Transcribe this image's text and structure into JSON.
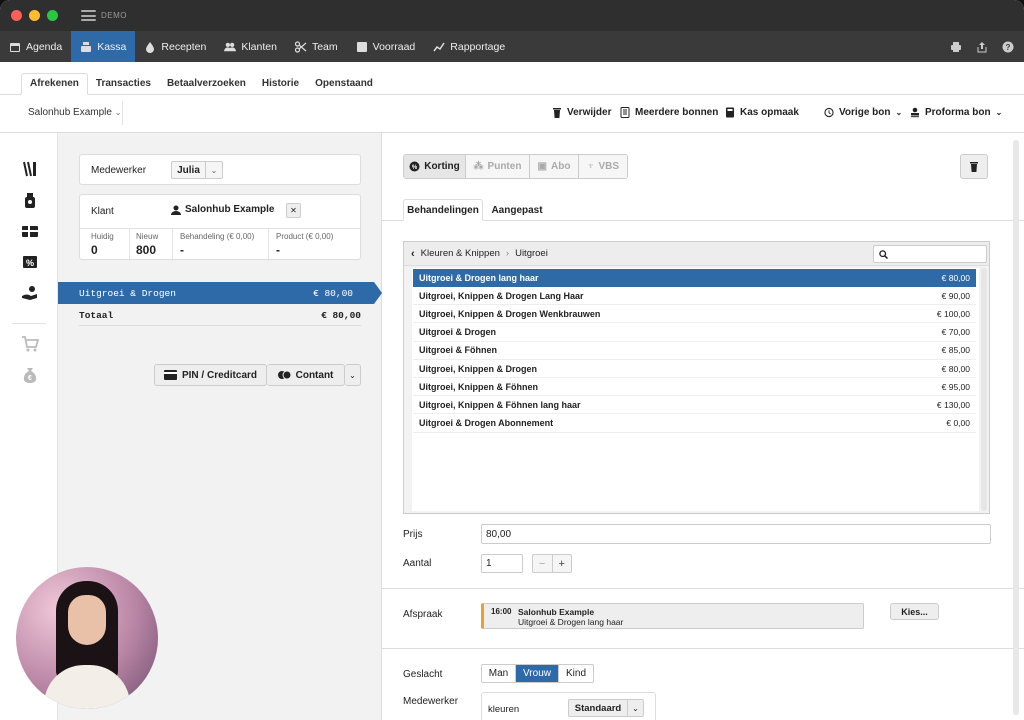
{
  "window": {
    "demo_label": "DEMO"
  },
  "nav": {
    "items": [
      {
        "label": "Agenda",
        "icon": "calendar-icon"
      },
      {
        "label": "Kassa",
        "icon": "cash-register-icon",
        "active": true
      },
      {
        "label": "Recepten",
        "icon": "drop-icon"
      },
      {
        "label": "Klanten",
        "icon": "users-icon"
      },
      {
        "label": "Team",
        "icon": "scissors-icon"
      },
      {
        "label": "Voorraad",
        "icon": "box-icon"
      },
      {
        "label": "Rapportage",
        "icon": "chart-line-icon"
      }
    ]
  },
  "subtabs": [
    "Afrekenen",
    "Transacties",
    "Betaalverzoeken",
    "Historie",
    "Openstaand"
  ],
  "toolbar": {
    "salon": "Salonhub Example",
    "delete": "Verwijder",
    "multiple": "Meerdere bonnen",
    "cash_up": "Kas opmaak",
    "previous": "Vorige bon",
    "proforma": "Proforma bon"
  },
  "left": {
    "employee_label": "Medewerker",
    "employee_value": "Julia",
    "client_label": "Klant",
    "client_value": "Salonhub Example",
    "stats": [
      {
        "label": "Huidig",
        "value": "0"
      },
      {
        "label": "Nieuw",
        "value": "800"
      },
      {
        "label": "Behandeling (€ 0,00)",
        "value": "-"
      },
      {
        "label": "Product (€ 0,00)",
        "value": "-"
      }
    ],
    "line_item": {
      "name": "Uitgroei & Drogen",
      "price": "€ 80,00"
    },
    "total": {
      "label": "Totaal",
      "price": "€ 80,00"
    },
    "pay_card": "PIN / Creditcard",
    "pay_cash": "Contant"
  },
  "right": {
    "chips": [
      "Korting",
      "Punten",
      "Abo",
      "VBS"
    ],
    "tabs": [
      "Behandelingen",
      "Aangepast"
    ],
    "breadcrumb": [
      "Kleuren & Knippen",
      "Uitgroei"
    ],
    "treatments": [
      {
        "name": "Uitgroei & Drogen lang haar",
        "price": "€ 80,00",
        "selected": true
      },
      {
        "name": "Uitgroei, Knippen & Drogen Lang Haar",
        "price": "€ 90,00"
      },
      {
        "name": "Uitgroei, Knippen & Drogen Wenkbrauwen",
        "price": "€ 100,00"
      },
      {
        "name": "Uitgroei & Drogen",
        "price": "€ 70,00"
      },
      {
        "name": "Uitgroei & Föhnen",
        "price": "€ 85,00"
      },
      {
        "name": "Uitgroei, Knippen & Drogen",
        "price": "€ 80,00"
      },
      {
        "name": "Uitgroei, Knippen & Föhnen",
        "price": "€ 95,00"
      },
      {
        "name": "Uitgroei, Knippen & Föhnen lang haar",
        "price": "€ 130,00"
      },
      {
        "name": "Uitgroei & Drogen Abonnement",
        "price": "€ 0,00"
      }
    ],
    "price_label": "Prijs",
    "price_value": "80,00",
    "qty_label": "Aantal",
    "qty_value": "1",
    "appt_label": "Afspraak",
    "appt_time": "16:00",
    "appt_client": "Salonhub Example",
    "appt_treatment": "Uitgroei & Drogen lang haar",
    "choose": "Kies...",
    "gender_label": "Geslacht",
    "genders": [
      "Man",
      "Vrouw",
      "Kind"
    ],
    "emp_label": "Medewerker",
    "emp_role": "kleuren",
    "emp_value": "Standaard"
  },
  "colors": {
    "accent": "#2f6aa8",
    "appt_bar": "#e8a030"
  }
}
